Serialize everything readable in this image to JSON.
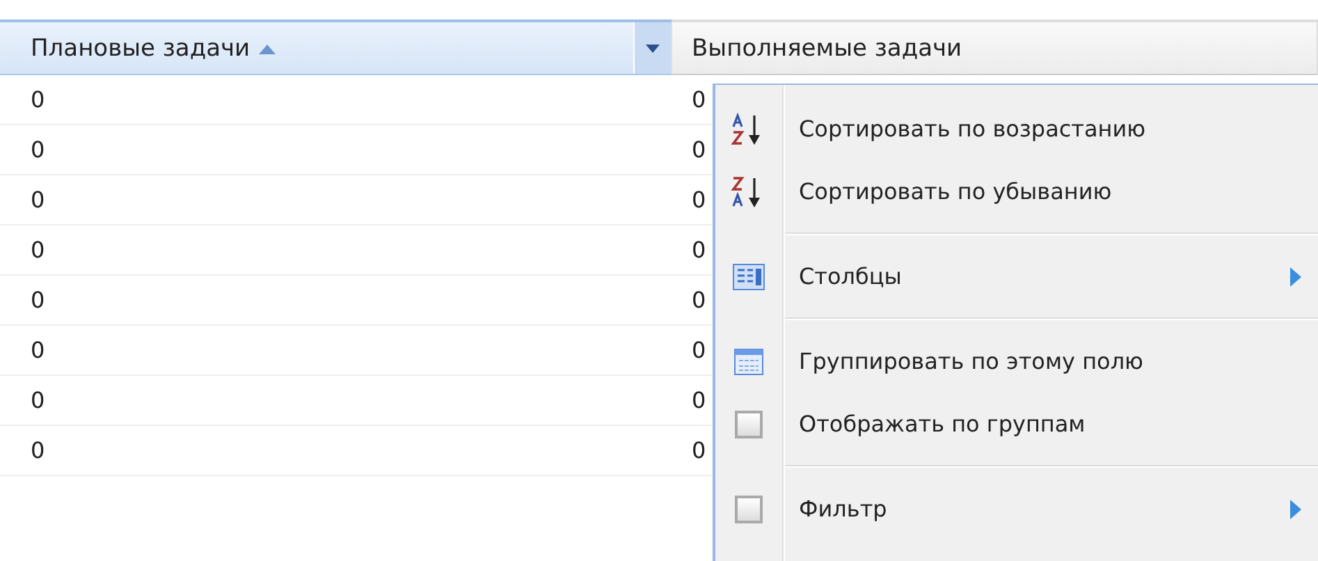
{
  "columns": [
    {
      "label": "Плановые задачи",
      "sorted": true,
      "active": true
    },
    {
      "label": "Выполняемые задачи",
      "sorted": false,
      "active": false
    }
  ],
  "rows": [
    {
      "cells": [
        "0",
        "0"
      ]
    },
    {
      "cells": [
        "0",
        "0"
      ]
    },
    {
      "cells": [
        "0",
        "0"
      ]
    },
    {
      "cells": [
        "0",
        "0"
      ]
    },
    {
      "cells": [
        "0",
        "0"
      ]
    },
    {
      "cells": [
        "0",
        "0"
      ]
    },
    {
      "cells": [
        "0",
        "0"
      ]
    },
    {
      "cells": [
        "0",
        "0"
      ]
    }
  ],
  "menu": [
    {
      "kind": "sort-asc",
      "label": "Сортировать по возрастанию",
      "submenu": false
    },
    {
      "kind": "sort-desc",
      "label": "Сортировать по убыванию",
      "submenu": false
    },
    {
      "kind": "separator"
    },
    {
      "kind": "columns",
      "label": "Столбцы",
      "submenu": true
    },
    {
      "kind": "separator"
    },
    {
      "kind": "group",
      "label": "Группировать по этому полю",
      "submenu": false
    },
    {
      "kind": "checkbox",
      "label": "Отображать по группам",
      "checked": false,
      "submenu": false
    },
    {
      "kind": "separator"
    },
    {
      "kind": "checkbox",
      "label": "Фильтр",
      "checked": false,
      "submenu": true
    }
  ]
}
